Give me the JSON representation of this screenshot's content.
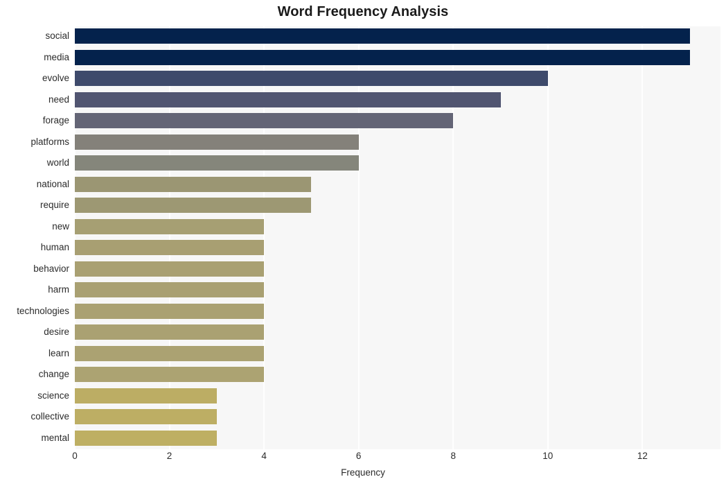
{
  "chart_data": {
    "type": "bar",
    "orientation": "horizontal",
    "title": "Word Frequency Analysis",
    "xlabel": "Frequency",
    "ylabel": "",
    "categories": [
      "social",
      "media",
      "evolve",
      "need",
      "forage",
      "platforms",
      "world",
      "national",
      "require",
      "new",
      "human",
      "behavior",
      "harm",
      "technologies",
      "desire",
      "learn",
      "change",
      "science",
      "collective",
      "mental"
    ],
    "values": [
      13,
      13,
      10,
      9,
      8,
      6,
      6,
      5,
      5,
      4,
      4,
      4,
      4,
      4,
      4,
      4,
      4,
      3,
      3,
      3
    ],
    "bar_colors": [
      "#04224c",
      "#04224c",
      "#3e4a6b",
      "#515571",
      "#646576",
      "#84817a",
      "#85867b",
      "#9b9673",
      "#9d9873",
      "#a69f73",
      "#a89f72",
      "#a9a072",
      "#a9a072",
      "#aaa172",
      "#aaa172",
      "#aba272",
      "#aca372",
      "#bcad64",
      "#bdae64",
      "#beaf63"
    ],
    "xlim": [
      0,
      13.65
    ],
    "xticks": [
      0,
      2,
      4,
      6,
      8,
      10,
      12
    ],
    "xtick_labels": [
      "0",
      "2",
      "4",
      "6",
      "8",
      "10",
      "12"
    ],
    "grid": true,
    "grid_axis": "x",
    "grid_color": "#ffffff",
    "plot_background": "#f7f7f7",
    "figure_background": "#ffffff",
    "legend": null,
    "legend_position": "none"
  }
}
